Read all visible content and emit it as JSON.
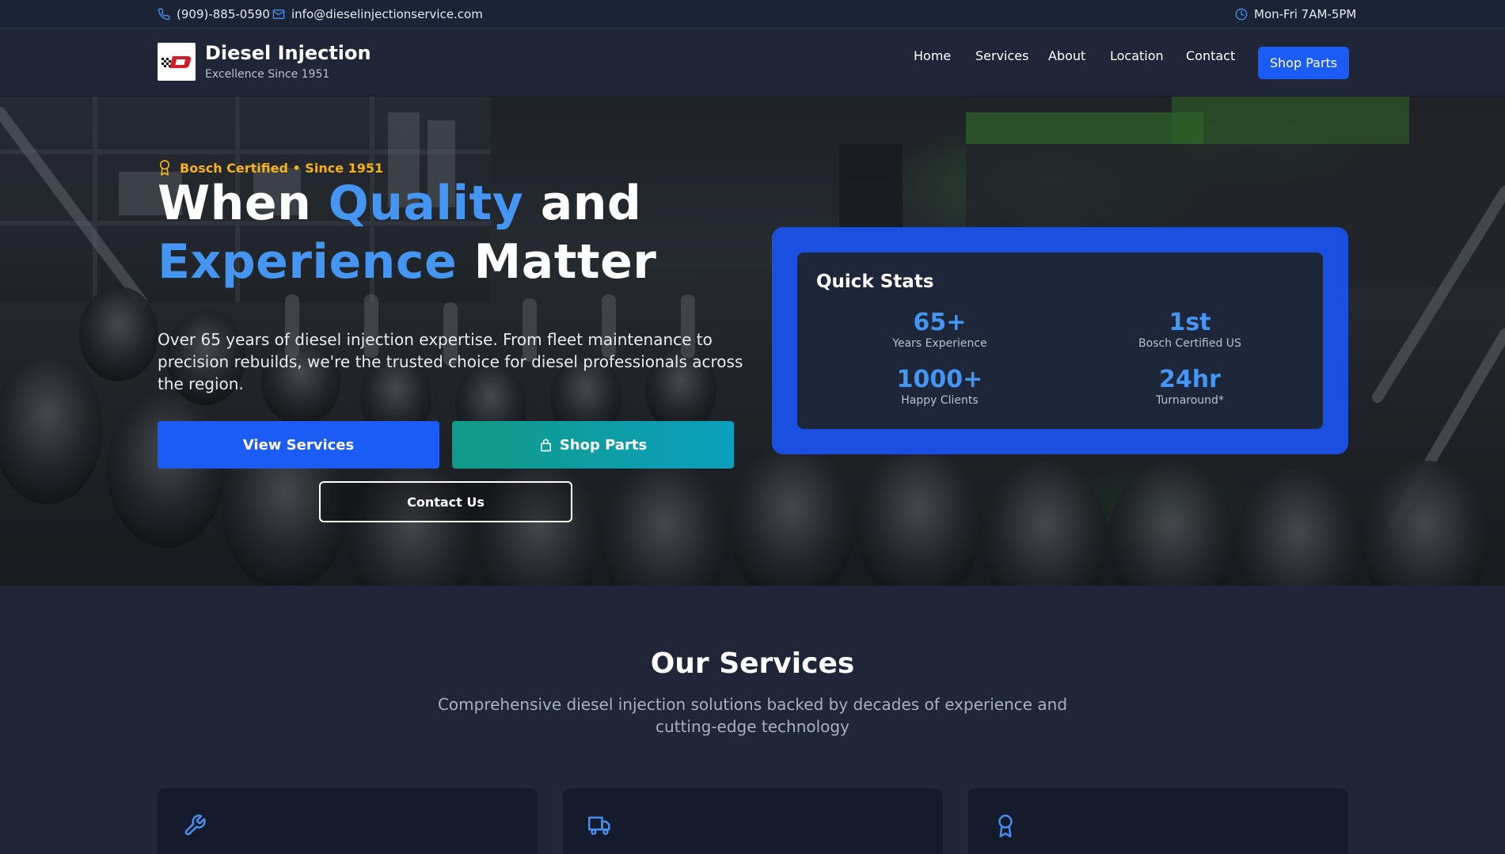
{
  "topbar": {
    "phone": "(909)-885-0590",
    "email": "info@dieselinjectionservice.com",
    "hours": "Mon-Fri 7AM-5PM"
  },
  "nav": {
    "brand_title": "Diesel Injection",
    "brand_sub": "Excellence Since 1951",
    "links": [
      "Home",
      "Services",
      "About",
      "Location",
      "Contact"
    ],
    "shop_button": "Shop Parts"
  },
  "hero": {
    "badge": "Bosch Certified • Since 1951",
    "headline_1a": "When ",
    "headline_1b": "Quality",
    "headline_1c": " and",
    "headline_2a": "Experience",
    "headline_2b": " Matter",
    "description": "Over 65 years of diesel injection expertise. From fleet maintenance to precision rebuilds, we're the trusted choice for diesel professionals across the region.",
    "btn_services": "View Services",
    "btn_shop": "Shop Parts",
    "btn_contact": "Contact Us"
  },
  "stats": {
    "title": "Quick Stats",
    "items": [
      {
        "value": "65+",
        "label": "Years Experience"
      },
      {
        "value": "1st",
        "label": "Bosch Certified US"
      },
      {
        "value": "1000+",
        "label": "Happy Clients"
      },
      {
        "value": "24hr",
        "label": "Turnaround*"
      }
    ]
  },
  "services": {
    "title": "Our Services",
    "subtitle": "Comprehensive diesel injection solutions backed by decades of experience and cutting-edge technology",
    "card_icons": [
      "wrench-icon",
      "truck-icon",
      "award-icon"
    ]
  },
  "colors": {
    "accent": "#4595f2",
    "primary_button": "#1a5cf5",
    "badge": "#f4b31a",
    "background": "#1e2638"
  }
}
